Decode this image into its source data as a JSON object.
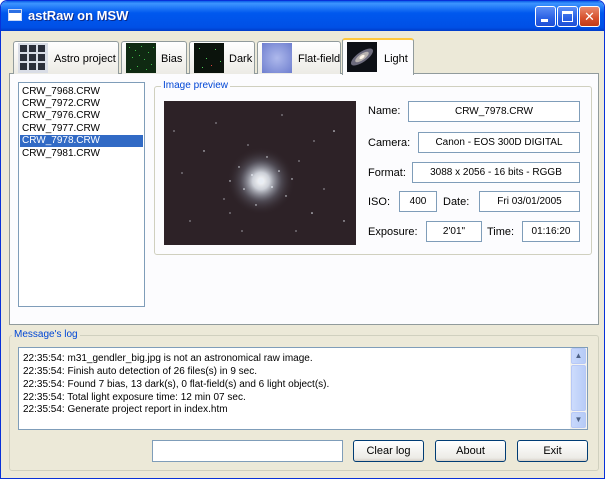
{
  "window": {
    "title": "astRaw on MSW"
  },
  "tabs": [
    {
      "label": "Astro project"
    },
    {
      "label": "Bias"
    },
    {
      "label": "Dark"
    },
    {
      "label": "Flat-field"
    },
    {
      "label": "Light"
    }
  ],
  "active_tab": "Light",
  "files": [
    "CRW_7968.CRW",
    "CRW_7972.CRW",
    "CRW_7976.CRW",
    "CRW_7977.CRW",
    "CRW_7978.CRW",
    "CRW_7981.CRW"
  ],
  "selected_file": "CRW_7978.CRW",
  "preview": {
    "group_title": "Image preview",
    "name_label": "Name:",
    "name": "CRW_7978.CRW",
    "camera_label": "Camera:",
    "camera": "Canon - EOS 300D DIGITAL",
    "format_label": "Format:",
    "format": "3088 x 2056 - 16 bits - RGGB",
    "iso_label": "ISO:",
    "iso": "400",
    "date_label": "Date:",
    "date": "Fri 03/01/2005",
    "exposure_label": "Exposure:",
    "exposure": "2'01\"",
    "time_label": "Time:",
    "time": "01:16:20"
  },
  "log": {
    "group_title": "Message's log",
    "lines": [
      "22:35:54: m31_gendler_big.jpg is not an astronomical raw image.",
      "22:35:54: Finish auto detection of 26 files(s) in 9 sec.",
      "22:35:54: Found 7 bias, 13 dark(s), 0 flat-field(s) and 6 light object(s).",
      "22:35:54: Total light exposure time: 12 min 07 sec.",
      "22:35:54: Generate project report in index.htm"
    ]
  },
  "bottom": {
    "input_value": "",
    "clear_label": "Clear log",
    "about_label": "About",
    "exit_label": "Exit"
  },
  "colors": {
    "titlebar": "#0058ee",
    "selection": "#316ac5",
    "group_title": "#0046d5",
    "tab_highlight": "#ffc83c"
  }
}
